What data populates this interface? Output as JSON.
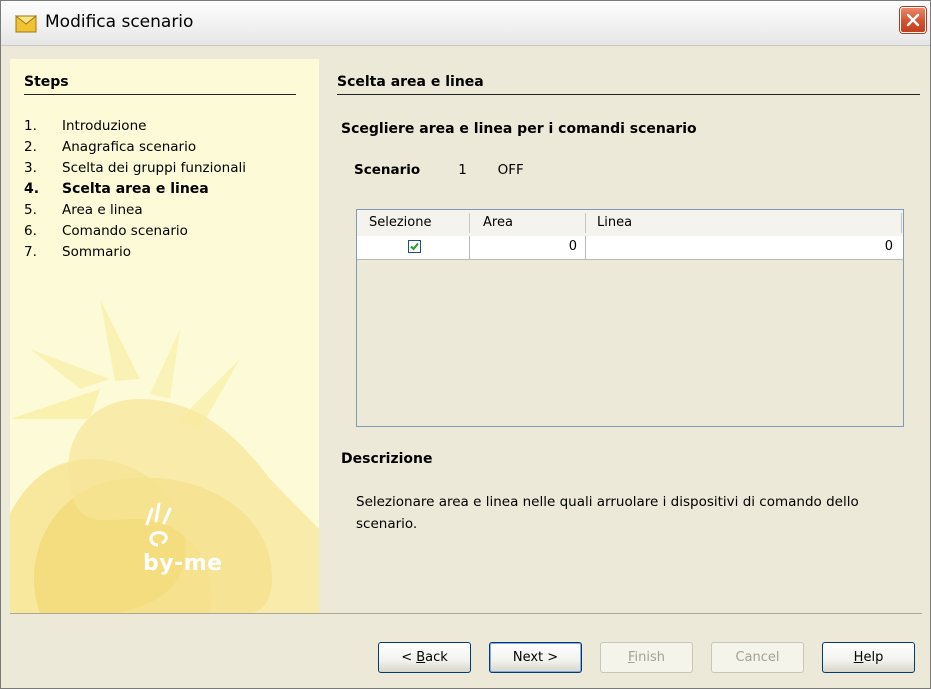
{
  "window": {
    "title": "Modifica scenario"
  },
  "steps": {
    "title": "Steps",
    "items": [
      {
        "num": "1.",
        "label": "Introduzione"
      },
      {
        "num": "2.",
        "label": "Anagrafica scenario"
      },
      {
        "num": "3.",
        "label": "Scelta dei gruppi funzionali"
      },
      {
        "num": "4.",
        "label": "Scelta area e linea"
      },
      {
        "num": "5.",
        "label": "Area e linea"
      },
      {
        "num": "6.",
        "label": "Comando scenario"
      },
      {
        "num": "7.",
        "label": "Sommario"
      }
    ],
    "current_index": 3,
    "logo_text": "by-me"
  },
  "content": {
    "title": "Scelta area e linea",
    "heading": "Scegliere area e linea per i comandi scenario",
    "scenario": {
      "label": "Scenario",
      "number": "1",
      "state": "OFF"
    },
    "table": {
      "headers": [
        "Selezione",
        "Area",
        "Linea"
      ],
      "rows": [
        {
          "selected": true,
          "area": "0",
          "linea": "0"
        }
      ]
    },
    "description": {
      "title": "Descrizione",
      "text": "Selezionare area e linea nelle quali arruolare i dispositivi di comando dello scenario."
    }
  },
  "buttons": {
    "back": {
      "prefix": "< ",
      "mnemonic": "B",
      "rest": "ack"
    },
    "next": "Next >",
    "finish": {
      "mnemonic": "F",
      "rest": "inish"
    },
    "cancel": "Cancel",
    "help": {
      "mnemonic": "H",
      "rest": "elp"
    }
  },
  "colors": {
    "steps_panel_bg": "#fdfbd7",
    "dialog_bg": "#ece9d8",
    "checkbox_check": "#21a121",
    "close_button": "#d35230"
  }
}
